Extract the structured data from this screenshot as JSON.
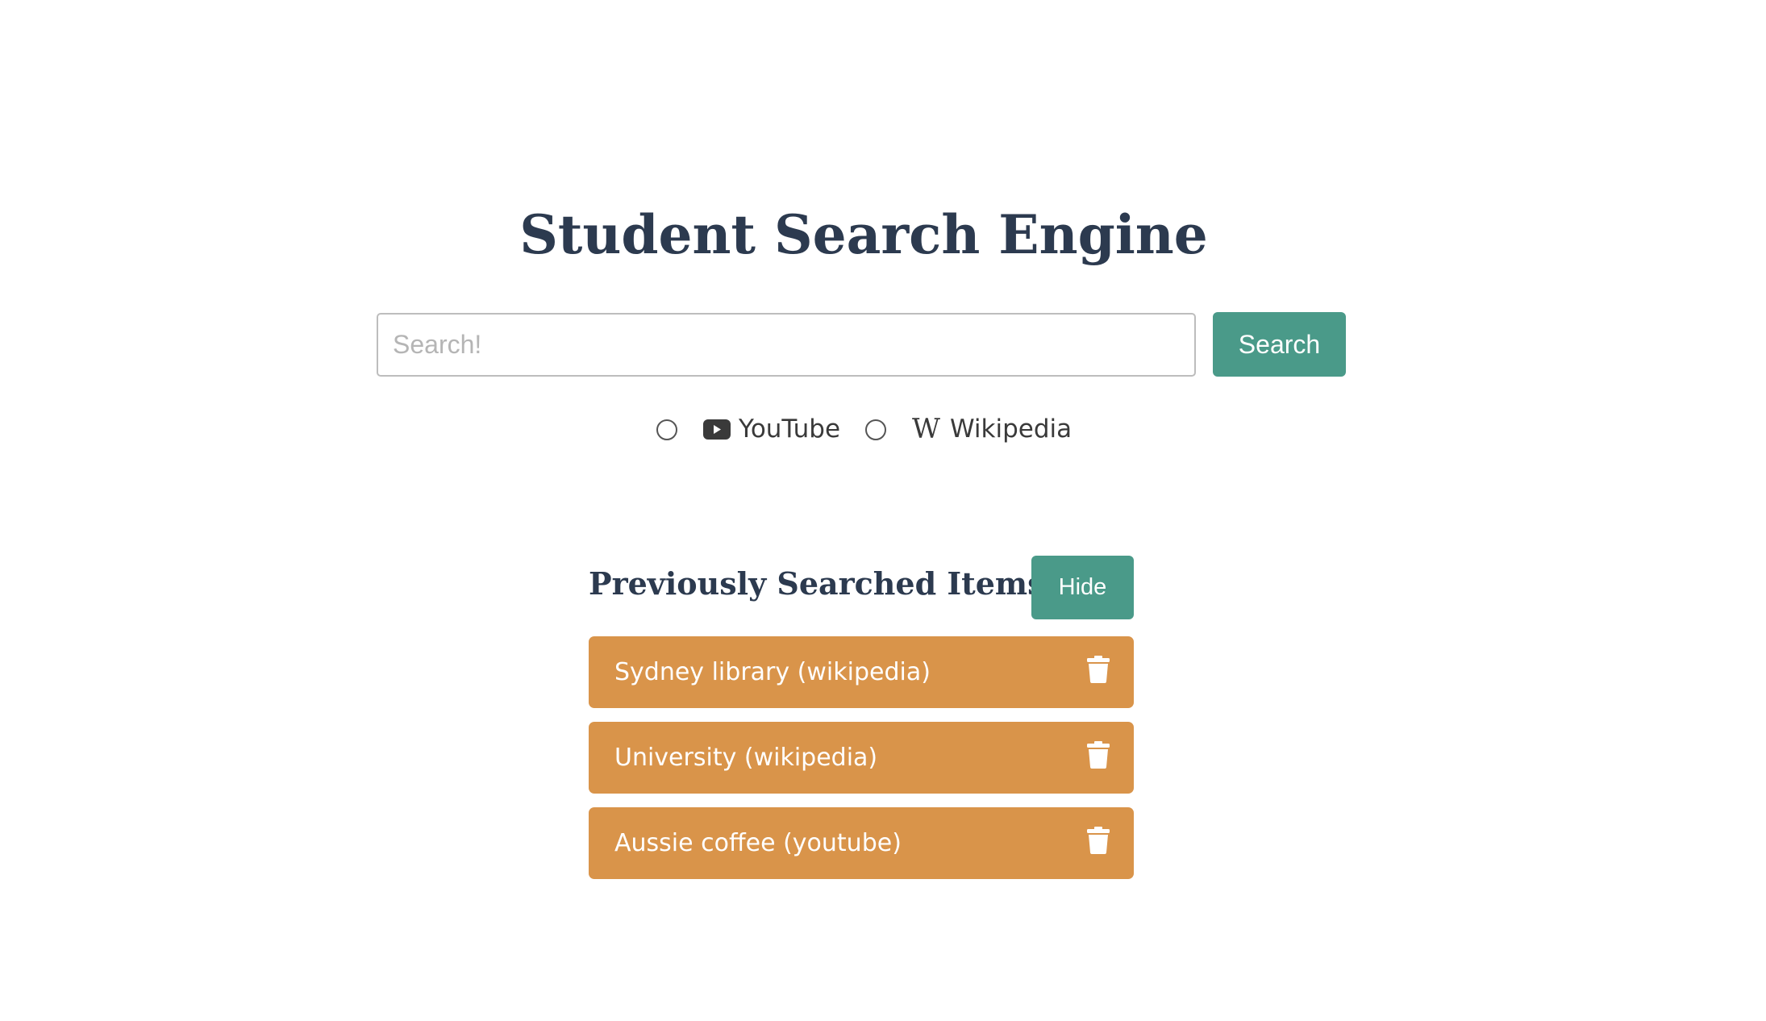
{
  "page": {
    "title": "Student Search Engine"
  },
  "search": {
    "placeholder": "Search!",
    "value": "",
    "button_label": "Search"
  },
  "sources": [
    {
      "label": "YouTube",
      "icon": "youtube-icon",
      "selected": false
    },
    {
      "label": "Wikipedia",
      "icon": "wikipedia-icon",
      "selected": false
    }
  ],
  "history": {
    "heading": "Previously Searched Items",
    "hide_label": "Hide",
    "items": [
      {
        "label": "Sydney library (wikipedia)"
      },
      {
        "label": "University (wikipedia)"
      },
      {
        "label": "Aussie coffee (youtube)"
      }
    ]
  },
  "colors": {
    "accent": "#4a9a89",
    "history_item": "#d9944a",
    "heading": "#2c3a4f"
  }
}
